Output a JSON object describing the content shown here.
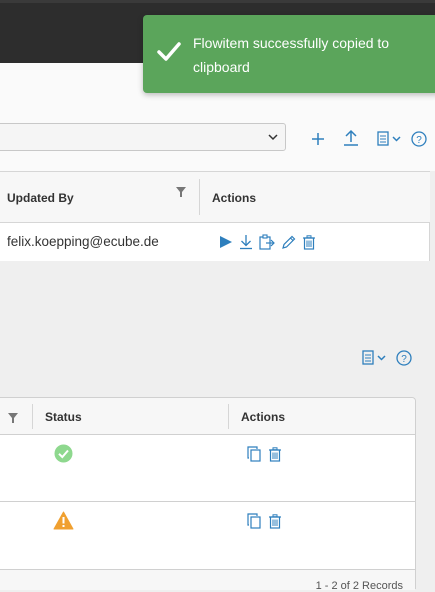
{
  "toast": {
    "message": "Flowitem successfully copied to clipboard",
    "icon": "checkmark-icon",
    "color": "#5ba55b"
  },
  "toolbar": {
    "icons": [
      "plus-icon",
      "upload-icon",
      "columns-menu-icon",
      "help-icon"
    ]
  },
  "upper_table": {
    "columns": [
      "Updated By",
      "Actions"
    ],
    "rows": [
      {
        "updated_by": "felix.koepping@ecube.de",
        "actions": [
          "play-icon",
          "download-icon",
          "copy-to-clipboard-icon",
          "edit-icon",
          "delete-icon"
        ]
      }
    ]
  },
  "lower_table": {
    "columns": [
      "Status",
      "Actions"
    ],
    "rows": [
      {
        "status": "success",
        "actions": [
          "copy-icon",
          "delete-icon"
        ]
      },
      {
        "status": "warning",
        "actions": [
          "copy-icon",
          "delete-icon"
        ]
      }
    ],
    "footer": "1 - 2 of 2 Records"
  },
  "colors": {
    "accent": "#2e7fbd",
    "success": "#8ed88e",
    "warning": "#f0a030"
  }
}
